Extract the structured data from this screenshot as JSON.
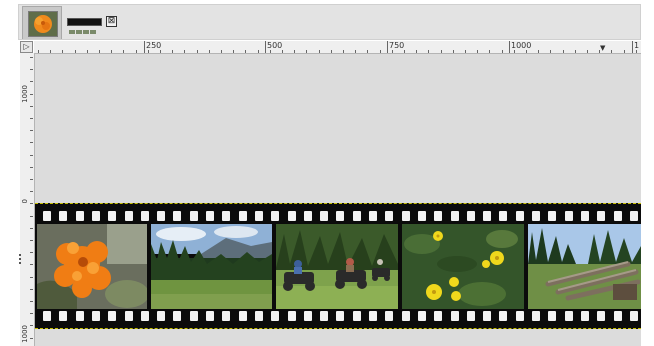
{
  "tabs": {
    "image_tab": {
      "name": "flower-thumbnail"
    },
    "filmstrip_tab": {
      "name": "filmstrip-thumbnail",
      "close_glyph": "⊠"
    }
  },
  "ruler": {
    "corner_glyph": "▷",
    "horizontal_labels": [
      "250",
      "500",
      "750",
      "1000",
      "1"
    ],
    "vertical_labels": [
      "1000",
      "0",
      "1000"
    ]
  },
  "canvas": {
    "background": "#dcdcdc",
    "film_color": "#0b0b0b",
    "frames": [
      {
        "name": "photo-orange-flower"
      },
      {
        "name": "photo-forest-meadow"
      },
      {
        "name": "photo-atv-riders"
      },
      {
        "name": "photo-yellow-flowers"
      },
      {
        "name": "photo-log-pile"
      }
    ]
  }
}
